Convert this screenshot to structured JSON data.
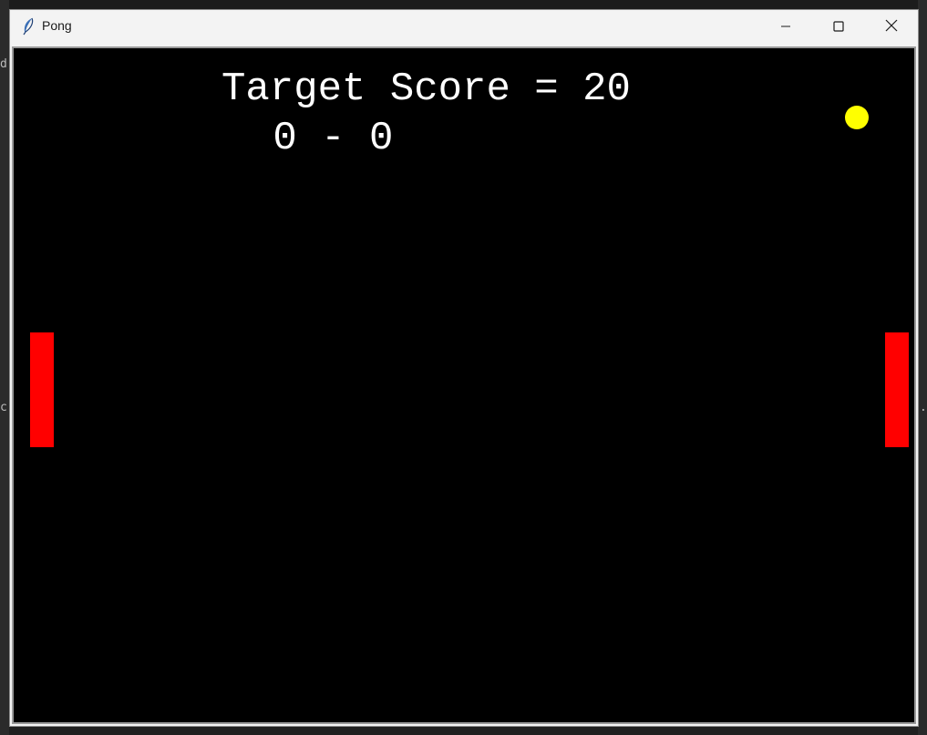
{
  "window": {
    "title": "Pong",
    "app_icon": "feather-icon",
    "controls": {
      "minimize_icon": "minimize-icon",
      "maximize_icon": "maximize-icon",
      "close_icon": "close-icon"
    }
  },
  "game": {
    "target_score_text": "Target Score = 20",
    "score_text": " 0 - 0",
    "colors": {
      "background": "#000000",
      "text": "#ffffff",
      "paddle": "#ff0000",
      "ball": "#ffff00"
    }
  },
  "background": {
    "left_glyph": "d",
    "left_glyph_2": "c",
    "right_glyph": "."
  }
}
